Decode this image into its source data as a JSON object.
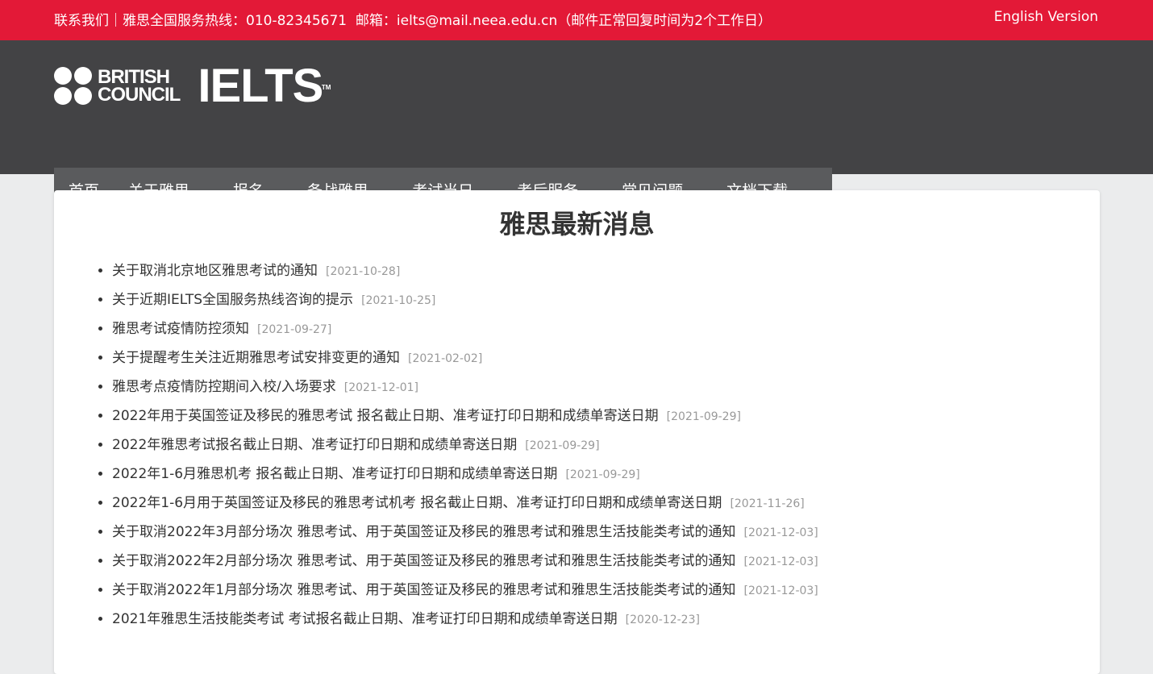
{
  "topbar": {
    "contact_label": "联系我们",
    "divider": "｜",
    "hotline": "雅思全国服务热线：010-82345671",
    "email": "邮箱：ielts@mail.neea.edu.cn（邮件正常回复时间为2个工作日）",
    "english_version": "English Version"
  },
  "logo": {
    "brand_line1": "BRITISH",
    "brand_line2": "COUNCIL",
    "product": "IELTS",
    "tm": "TM"
  },
  "nav": [
    {
      "label": "首页",
      "dropdown": false
    },
    {
      "label": "关于雅思",
      "dropdown": true
    },
    {
      "label": "报名",
      "dropdown": true
    },
    {
      "label": "备战雅思",
      "dropdown": true
    },
    {
      "label": "考试当日",
      "dropdown": true
    },
    {
      "label": "考后服务",
      "dropdown": true
    },
    {
      "label": "常见问题",
      "dropdown": true
    },
    {
      "label": "文档下载",
      "dropdown": false
    }
  ],
  "main": {
    "title": "雅思最新消息",
    "news": [
      {
        "title": "关于取消北京地区雅思考试的通知",
        "date": "[2021-10-28]"
      },
      {
        "title": "关于近期IELTS全国服务热线咨询的提示",
        "date": "[2021-10-25]"
      },
      {
        "title": "雅思考试疫情防控须知",
        "date": "[2021-09-27]"
      },
      {
        "title": "关于提醒考生关注近期雅思考试安排变更的通知",
        "date": "[2021-02-02]"
      },
      {
        "title": "雅思考点疫情防控期间入校/入场要求",
        "date": "[2021-12-01]"
      },
      {
        "title": "2022年用于英国签证及移民的雅思考试 报名截止日期、准考证打印日期和成绩单寄送日期",
        "date": "[2021-09-29]"
      },
      {
        "title": "2022年雅思考试报名截止日期、准考证打印日期和成绩单寄送日期",
        "date": "[2021-09-29]"
      },
      {
        "title": "2022年1-6月雅思机考 报名截止日期、准考证打印日期和成绩单寄送日期",
        "date": "[2021-09-29]"
      },
      {
        "title": "2022年1-6月用于英国签证及移民的雅思考试机考 报名截止日期、准考证打印日期和成绩单寄送日期",
        "date": "[2021-11-26]"
      },
      {
        "title": "关于取消2022年3月部分场次 雅思考试、用于英国签证及移民的雅思考试和雅思生活技能类考试的通知",
        "date": "[2021-12-03]"
      },
      {
        "title": "关于取消2022年2月部分场次 雅思考试、用于英国签证及移民的雅思考试和雅思生活技能类考试的通知",
        "date": "[2021-12-03]"
      },
      {
        "title": "关于取消2022年1月部分场次 雅思考试、用于英国签证及移民的雅思考试和雅思生活技能类考试的通知",
        "date": "[2021-12-03]"
      },
      {
        "title": "2021年雅思生活技能类考试 考试报名截止日期、准考证打印日期和成绩单寄送日期",
        "date": "[2020-12-23]"
      }
    ]
  },
  "colors": {
    "topbar": "#e31937",
    "header": "#434345",
    "nav": "#5a5b5d",
    "background": "#ebeced",
    "date": "#999999"
  }
}
